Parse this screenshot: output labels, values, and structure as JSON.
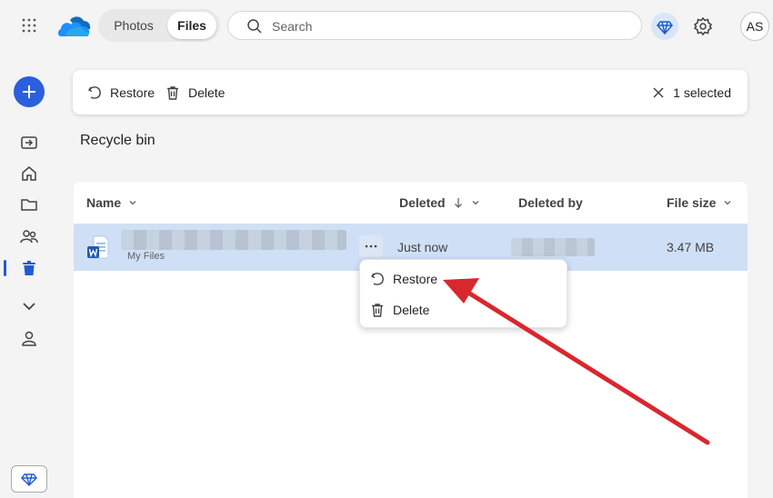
{
  "app": {
    "tabs": [
      {
        "label": "Photos"
      },
      {
        "label": "Files"
      }
    ],
    "search_placeholder": "Search",
    "avatar_initials": "AS"
  },
  "toolbar": {
    "restore_label": "Restore",
    "delete_label": "Delete",
    "selected_label": "1 selected"
  },
  "page_title": "Recycle bin",
  "table": {
    "columns": [
      {
        "label": "Name"
      },
      {
        "label": "Deleted"
      },
      {
        "label": "Deleted by"
      },
      {
        "label": "File size"
      }
    ],
    "rows": [
      {
        "location": "My Files",
        "deleted": "Just now",
        "size": "3.47 MB",
        "selected": true
      }
    ]
  },
  "context_menu": {
    "items": [
      {
        "label": "Restore",
        "icon": "restore-icon"
      },
      {
        "label": "Delete",
        "icon": "trash-icon"
      }
    ]
  },
  "colors": {
    "accent": "#2b5fdb",
    "selected_row": "#cfe0f6",
    "annotation_arrow": "#d9272e"
  }
}
